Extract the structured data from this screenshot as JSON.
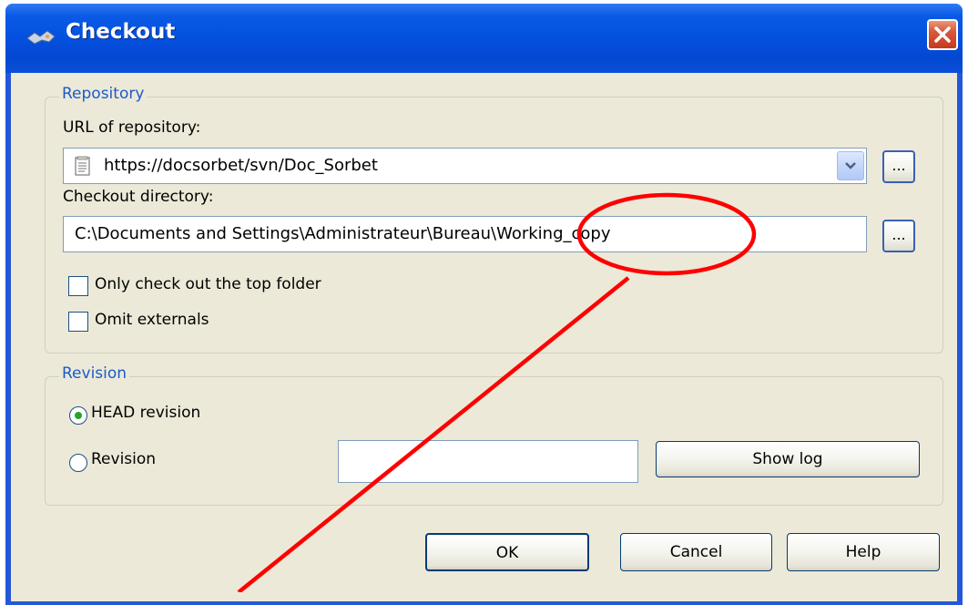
{
  "window": {
    "title": "Checkout"
  },
  "repository_group": {
    "title": "Repository",
    "url_label": "URL of repository:",
    "url_value": "https://docsorbet/svn/Doc_Sorbet",
    "browse_label": "...",
    "checkout_dir_label": "Checkout directory:",
    "checkout_dir_value": "C:\\Documents and Settings\\Administrateur\\Bureau\\Working_copy",
    "checkout_browse_label": "...",
    "only_top_folder_label": "Only check out the top folder",
    "only_top_folder_checked": false,
    "omit_externals_label": "Omit externals",
    "omit_externals_checked": false
  },
  "revision_group": {
    "title": "Revision",
    "head_label": "HEAD revision",
    "head_selected": true,
    "revision_label": "Revision",
    "revision_selected": false,
    "revision_value": "",
    "show_log_label": "Show log"
  },
  "buttons": {
    "ok": "OK",
    "cancel": "Cancel",
    "help": "Help"
  },
  "colors": {
    "titlebar": "#0450df",
    "dialog_bg": "#ece9d8",
    "group_title": "#1c5ac8",
    "annotation": "#ff0000"
  },
  "icons": {
    "title": "checkout-app-icon",
    "close": "close-icon",
    "url_field": "document-icon",
    "dropdown": "chevron-down-icon"
  }
}
